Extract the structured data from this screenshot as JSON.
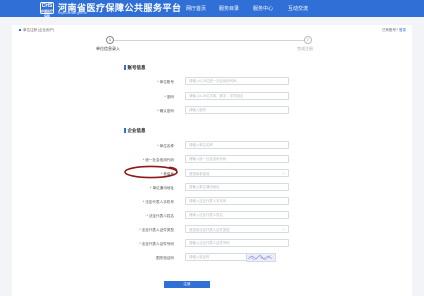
{
  "header": {
    "logo_main": "CHS",
    "logo_sub": "中国医疗保障",
    "title": "河南省医疗保障公共服务平台",
    "url": "hnyb.henan.gov.cn",
    "nav": [
      "网厅首页",
      "服务目录",
      "服务中心",
      "互动交流"
    ]
  },
  "breadcrumb": "单位注册 (企业用户)",
  "help": {
    "prefix": "已有账号?",
    "link": "登录"
  },
  "steps": [
    {
      "number": "1",
      "label": "单位信息录入"
    },
    {
      "number": "2",
      "label": "完成注册"
    }
  ],
  "account_section": {
    "title": "账号信息",
    "rows": [
      {
        "label": "单位账号",
        "required": true,
        "placeholder": "请输入6-20位统一社会信用代码"
      },
      {
        "label": "密码",
        "required": true,
        "placeholder": "请输入8-16位字母、数字、字符组合"
      },
      {
        "label": "确认密码",
        "required": true,
        "placeholder": "请输入密码"
      }
    ]
  },
  "company_section": {
    "title": "企业信息",
    "rows": [
      {
        "label": "单位名称",
        "required": true,
        "placeholder": "请输入单位名称"
      },
      {
        "label": "统一社会信用代码",
        "required": true,
        "placeholder": "请输入统一社会信用代码"
      },
      {
        "label": "参保地",
        "required": true,
        "placeholder": "请选择参保地",
        "type": "select"
      },
      {
        "label": "单位通讯地址",
        "required": true,
        "placeholder": "请输入单位通讯地址"
      },
      {
        "label": "法定代表人手机号",
        "required": true,
        "placeholder": "请输入法定代表人手机号"
      },
      {
        "label": "法定代表人姓名",
        "required": true,
        "placeholder": "请输入法定代表人姓名"
      },
      {
        "label": "法定代表人证件类型",
        "required": true,
        "placeholder": "请选择法定代表人证件类型",
        "type": "select"
      },
      {
        "label": "法定代表人证件号码",
        "required": true,
        "placeholder": "请输入法定代表人证件号码"
      },
      {
        "label": "图形验证码",
        "required": false,
        "placeholder": "请输入验证码",
        "type": "captcha"
      }
    ]
  },
  "submit_label": "注册",
  "colors": {
    "primary": "#2f6fd6",
    "required": "#e02020",
    "annotation": "#8b1a1a"
  }
}
